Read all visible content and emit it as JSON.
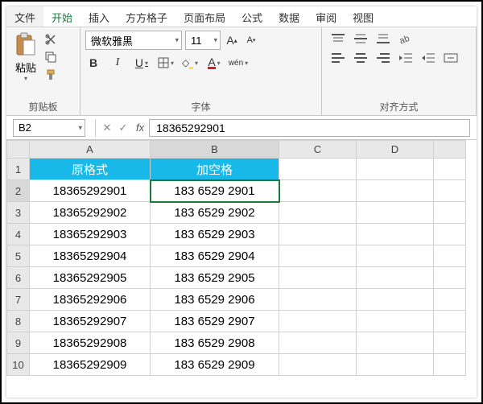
{
  "tabs": [
    "文件",
    "开始",
    "插入",
    "方方格子",
    "页面布局",
    "公式",
    "数据",
    "审阅",
    "视图"
  ],
  "active_tab_index": 1,
  "ribbon": {
    "clipboard": {
      "paste_label": "粘贴",
      "group_label": "剪贴板"
    },
    "font": {
      "name": "微软雅黑",
      "size": "11",
      "grow": "A",
      "shrink": "A",
      "bold": "B",
      "italic": "I",
      "underline": "U",
      "wen": "wén",
      "group_label": "字体"
    },
    "align": {
      "group_label": "对齐方式"
    }
  },
  "namebox": "B2",
  "formula": "18365292901",
  "columns": [
    "A",
    "B",
    "C",
    "D",
    ""
  ],
  "row_numbers": [
    1,
    2,
    3,
    4,
    5,
    6,
    7,
    8,
    9,
    10
  ],
  "headers": {
    "a": "原格式",
    "b": "加空格"
  },
  "rows": [
    {
      "a": "18365292901",
      "b": "183 6529 2901"
    },
    {
      "a": "18365292902",
      "b": "183 6529 2902"
    },
    {
      "a": "18365292903",
      "b": "183 6529 2903"
    },
    {
      "a": "18365292904",
      "b": "183 6529 2904"
    },
    {
      "a": "18365292905",
      "b": "183 6529 2905"
    },
    {
      "a": "18365292906",
      "b": "183 6529 2906"
    },
    {
      "a": "18365292907",
      "b": "183 6529 2907"
    },
    {
      "a": "18365292908",
      "b": "183 6529 2908"
    },
    {
      "a": "18365292909",
      "b": "183 6529 2909"
    }
  ],
  "active_cell": {
    "row": 2,
    "col": "B"
  }
}
